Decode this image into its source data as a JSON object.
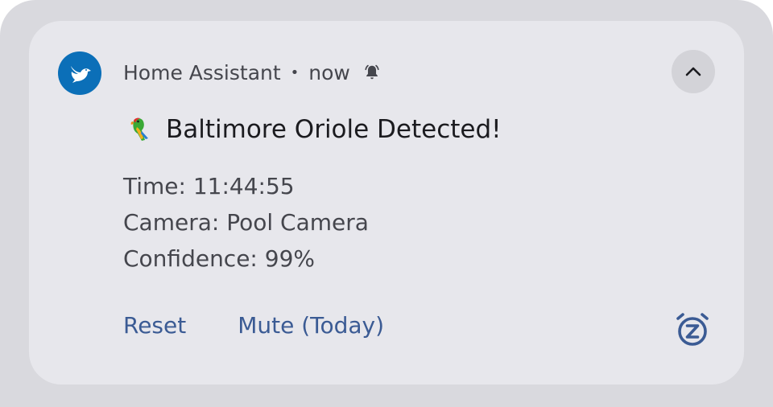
{
  "notification": {
    "app_name": "Home Assistant",
    "separator": "•",
    "time": "now",
    "title_emoji": "🦜",
    "title": "Baltimore Oriole Detected!",
    "lines": [
      "Time: 11:44:55",
      "Camera: Pool Camera",
      "Confidence: 99%"
    ],
    "actions": [
      "Reset",
      "Mute (Today)"
    ],
    "icons": {
      "app": "bird-icon",
      "alert": "bell-icon",
      "collapse": "chevron-up-icon",
      "snooze": "snooze-clock-icon"
    },
    "colors": {
      "app_icon_bg": "#0b6fb8",
      "action_text": "#3b5b94"
    }
  }
}
